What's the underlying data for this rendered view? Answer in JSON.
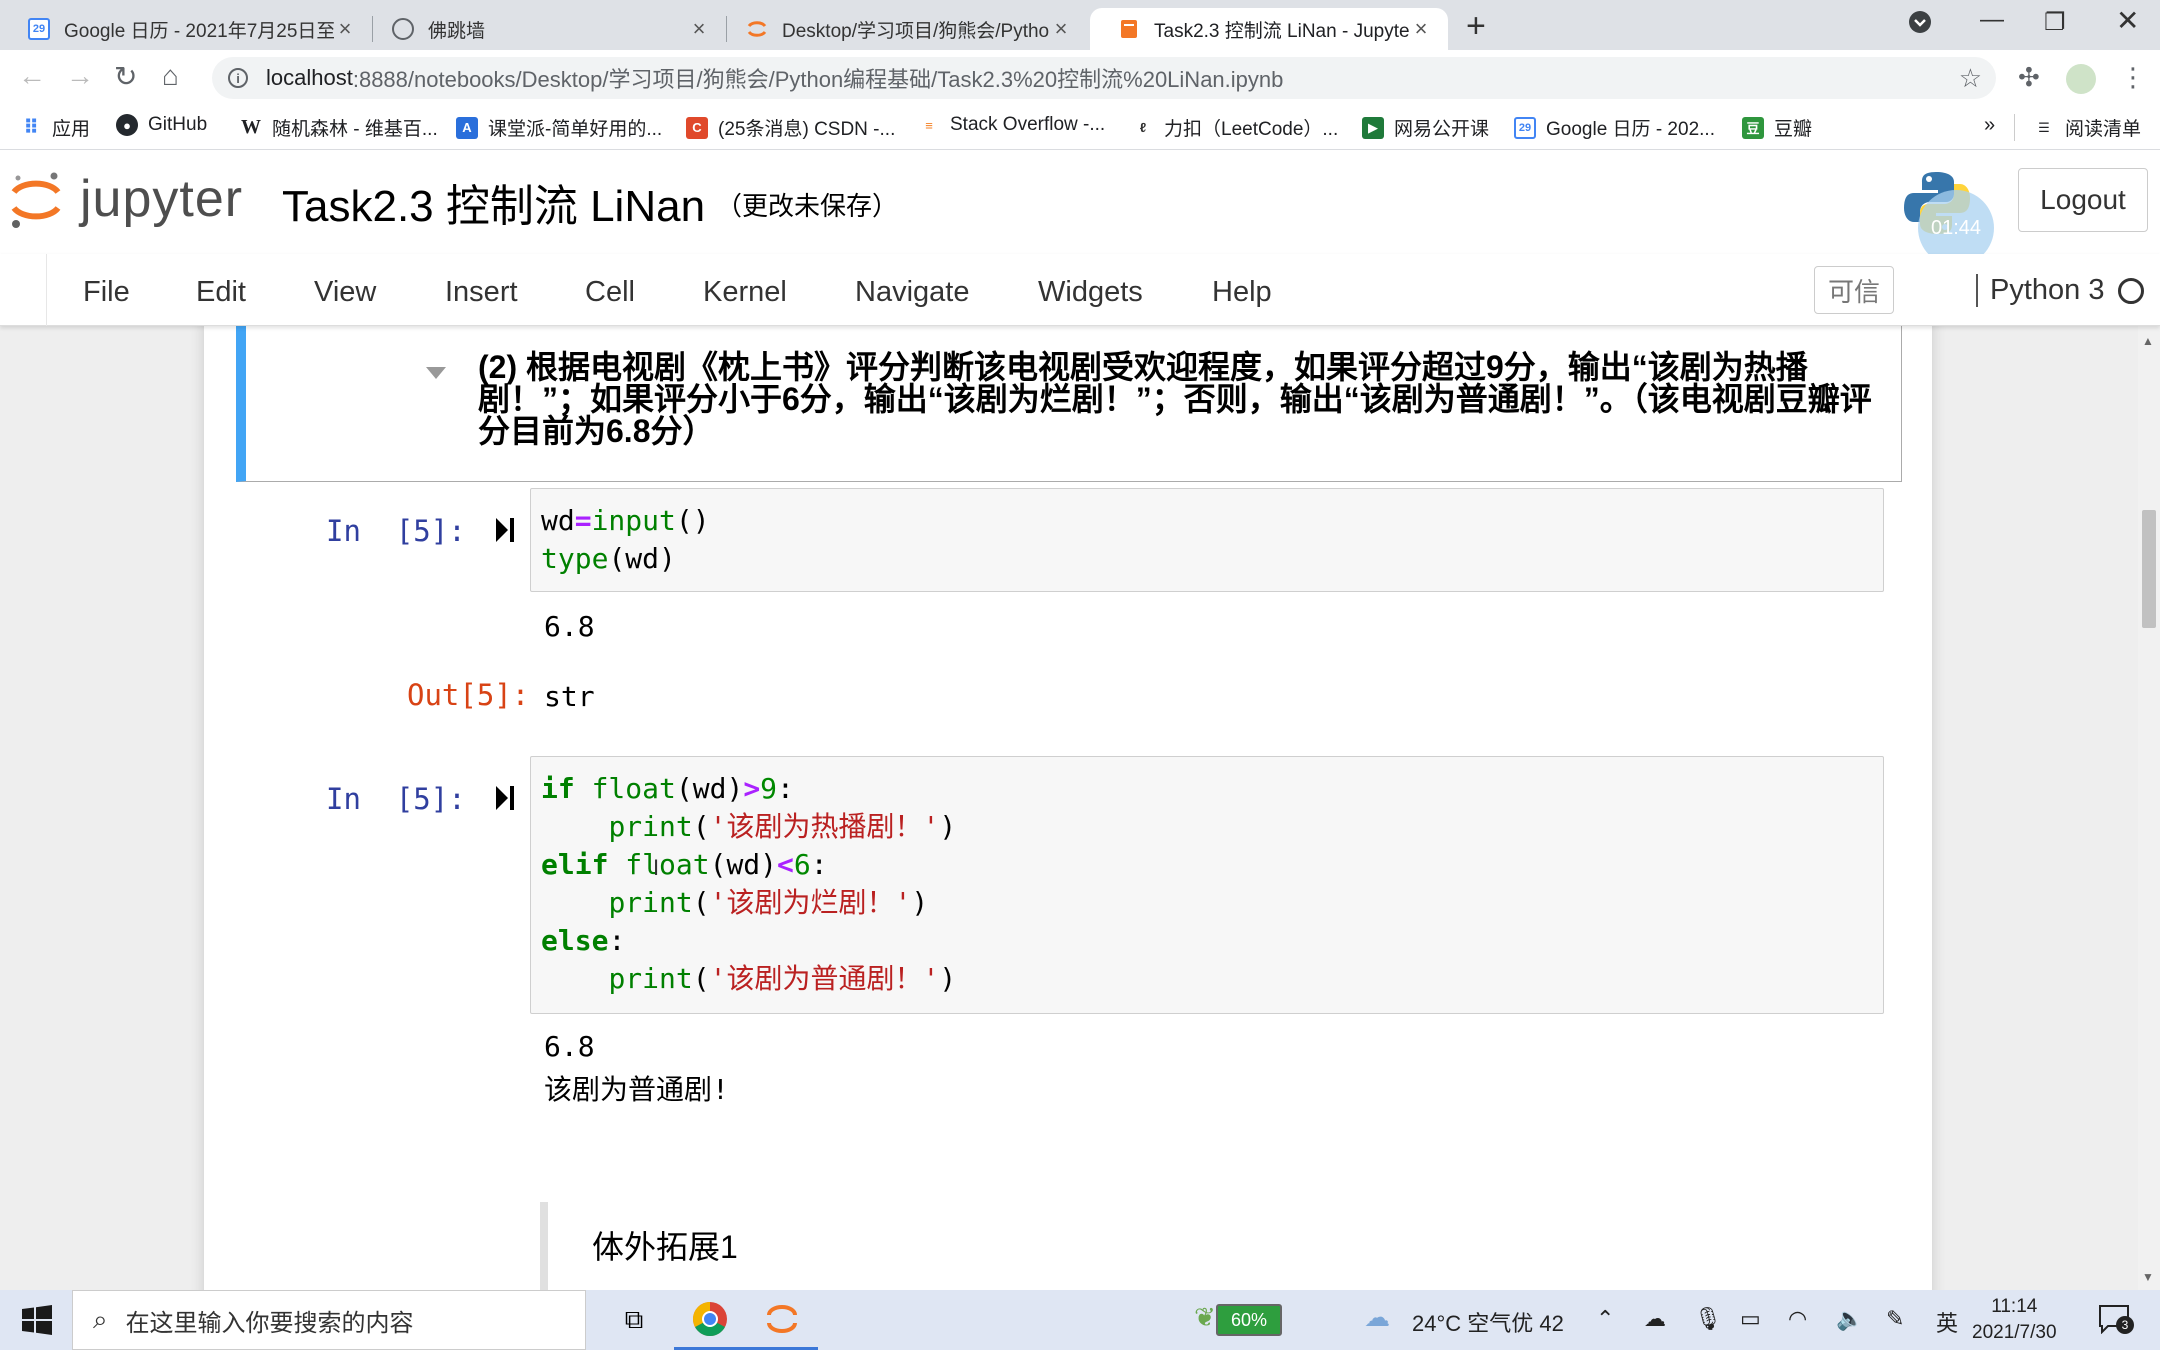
{
  "browser": {
    "tabs": [
      {
        "title": "Google 日历 - 2021年7月25日至",
        "favicon": "calendar-icon",
        "active": false
      },
      {
        "title": "佛跳墙",
        "favicon": "globe-icon",
        "active": false
      },
      {
        "title": "Desktop/学习项目/狗熊会/Pytho",
        "favicon": "jupyter-icon",
        "active": false
      },
      {
        "title": "Task2.3 控制流 LiNan - Jupyter",
        "favicon": "notebook-icon",
        "active": true
      }
    ],
    "url_host": "localhost",
    "url_path": ":8888/notebooks/Desktop/学习项目/狗熊会/Python编程基础/Task2.3%20控制流%20LiNan.ipynb",
    "bookmarks": [
      {
        "label": "应用",
        "icon": "apps-grid-icon"
      },
      {
        "label": "GitHub",
        "icon": "github-icon"
      },
      {
        "label": "随机森林 - 维基百...",
        "icon": "wikipedia-icon"
      },
      {
        "label": "课堂派-简单好用的...",
        "icon": "ketangpai-icon"
      },
      {
        "label": "(25条消息) CSDN -...",
        "icon": "csdn-icon"
      },
      {
        "label": "Stack Overflow -...",
        "icon": "stackoverflow-icon"
      },
      {
        "label": "力扣（LeetCode）...",
        "icon": "leetcode-icon"
      },
      {
        "label": "网易公开课",
        "icon": "netease-icon"
      },
      {
        "label": "Google 日历 - 202...",
        "icon": "calendar-icon"
      },
      {
        "label": "豆瓣",
        "icon": "douban-icon"
      }
    ],
    "more_bookmarks": "»",
    "reading_list": "阅读清单"
  },
  "jupyter": {
    "logo_text": "jupyter",
    "notebook_name": "Task2.3 控制流 LiNan",
    "save_status": "（更改未保存）",
    "kernel_badge": "01:44",
    "logout_label": "Logout",
    "menu": [
      "File",
      "Edit",
      "View",
      "Insert",
      "Cell",
      "Kernel",
      "Navigate",
      "Widgets",
      "Help"
    ],
    "trusted_label": "可信",
    "kernel_name": "Python 3"
  },
  "cells": {
    "markdown_question": "(2) 根据电视剧《枕上书》评分判断该电视剧受欢迎程度，如果评分超过9分，输出“该剧为热播剧！”；如果评分小于6分，输出“该剧为烂剧！”；否则，输出“该剧为普通剧！”。（该电视剧豆瓣评分目前为6.8分）",
    "cell1": {
      "in_prompt": "In  [5]:",
      "out_prompt": "Out[5]:",
      "stdout": "6.8",
      "result": "str"
    },
    "cell2": {
      "in_prompt": "In  [5]:",
      "stdout_1": "6.8",
      "stdout_2": "该剧为普通剧!"
    },
    "extension_heading": "体外拓展1"
  },
  "taskbar": {
    "search_placeholder": "在这里输入你要搜索的内容",
    "battery": "60%",
    "weather": "24°C  空气优 42",
    "ime": "英",
    "time": "11:14",
    "date": "2021/7/30",
    "notification_count": "3"
  }
}
